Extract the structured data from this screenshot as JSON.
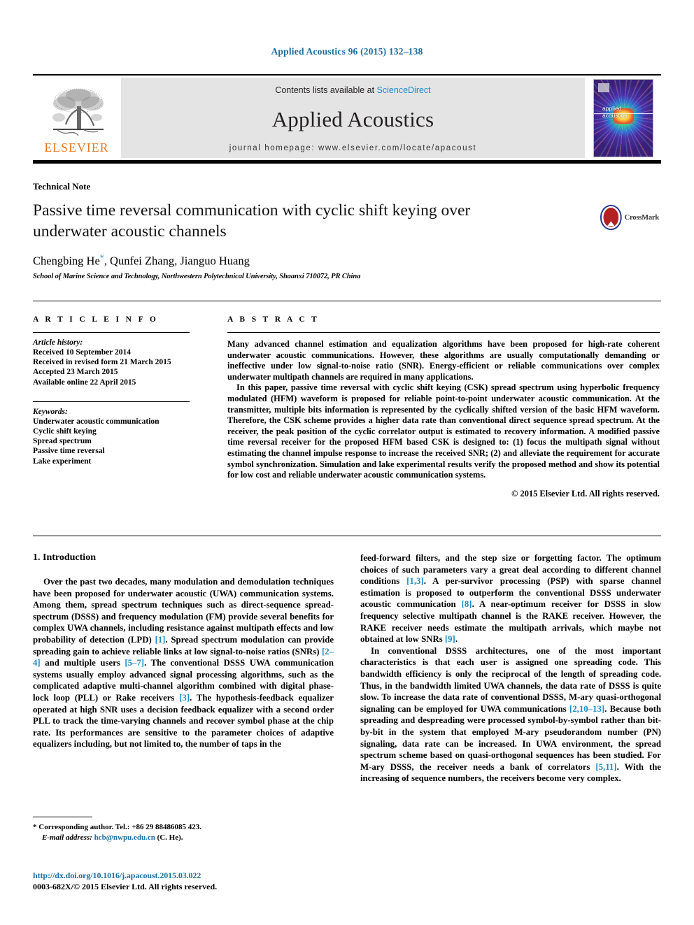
{
  "running_head": "Applied Acoustics 96 (2015) 132–138",
  "masthead": {
    "contents_prefix": "Contents lists available at ",
    "sciencedirect": "ScienceDirect",
    "journal_name": "Applied Acoustics",
    "homepage": "journal homepage: www.elsevier.com/locate/apacoust",
    "publisher": "ELSEVIER",
    "cover_title_line1": "applied",
    "cover_title_line2": "acoustics",
    "accent_blue": "#1a8cc9",
    "elsevier_orange": "#E87722"
  },
  "article": {
    "doctype": "Technical Note",
    "title": "Passive time reversal communication with cyclic shift keying over underwater acoustic channels",
    "authors_pre": "Chengbing He",
    "authors_star": "*",
    "authors_post": ", Qunfei Zhang, Jianguo Huang",
    "affiliation": "School of Marine Science and Technology, Northwestern Polytechnical University, Shaanxi 710072, PR China",
    "crossmark_label": "CrossMark"
  },
  "info": {
    "label": "A R T I C L E  I N F O",
    "history_head": "Article history:",
    "history": [
      "Received 10 September 2014",
      "Received in revised form 21 March 2015",
      "Accepted 23 March 2015",
      "Available online 22 April 2015"
    ],
    "keywords_head": "Keywords:",
    "keywords": [
      "Underwater acoustic communication",
      "Cyclic shift keying",
      "Spread spectrum",
      "Passive time reversal",
      "Lake experiment"
    ]
  },
  "abstract": {
    "label": "A B S T R A C T",
    "paragraphs": [
      "Many advanced channel estimation and equalization algorithms have been proposed for high-rate coherent underwater acoustic communications. However, these algorithms are usually computationally demanding or ineffective under low signal-to-noise ratio (SNR). Energy-efficient or reliable communications over complex underwater multipath channels are required in many applications.",
      "In this paper, passive time reversal with cyclic shift keying (CSK) spread spectrum using hyperbolic frequency modulated (HFM) waveform is proposed for reliable point-to-point underwater acoustic communication. At the transmitter, multiple bits information is represented by the cyclically shifted version of the basic HFM waveform. Therefore, the CSK scheme provides a higher data rate than conventional direct sequence spread spectrum. At the receiver, the peak position of the cyclic correlator output is estimated to recovery information. A modified passive time reversal receiver for the proposed HFM based CSK is designed to: (1) focus the multipath signal without estimating the channel impulse response to increase the received SNR; (2) and alleviate the requirement for accurate symbol synchronization. Simulation and lake experimental results verify the proposed method and show its potential for low cost and reliable underwater acoustic communication systems."
    ],
    "copyright": "© 2015 Elsevier Ltd. All rights reserved."
  },
  "body": {
    "section_heading": "1. Introduction",
    "left_paragraph_1_a": "Over the past two decades, many modulation and demodulation techniques have been proposed for underwater acoustic (UWA) communication systems. Among them, spread spectrum techniques such as direct-sequence spread-spectrum (DSSS) and frequency modulation (FM) provide several benefits for complex UWA channels, including resistance against multipath effects and low probability of detection (LPD) ",
    "ref_1": "[1]",
    "left_paragraph_1_b": ". Spread spectrum modulation can provide spreading gain to achieve reliable links at low signal-to-noise ratios (SNRs) ",
    "ref_2_4": "[2–4]",
    "left_paragraph_1_c": " and multiple users ",
    "ref_5_7": "[5–7]",
    "left_paragraph_1_d": ". The conventional DSSS UWA communication systems usually employ advanced signal processing algorithms, such as the complicated adaptive multi-channel algorithm combined with digital phase-lock loop (PLL) or Rake receivers ",
    "ref_3": "[3]",
    "left_paragraph_1_e": ". The hypothesis-feedback equalizer operated at high SNR uses a decision feedback equalizer with a second order PLL to track the time-varying channels and recover symbol phase at the chip rate. Its performances are sensitive to the parameter choices of adaptive equalizers including, but not limited to, the number of taps in the",
    "right_paragraph_1_a": "feed-forward filters, and the step size or forgetting factor. The optimum choices of such parameters vary a great deal according to different channel conditions ",
    "ref_1_3": "[1,3]",
    "right_paragraph_1_b": ". A per-survivor processing (PSP) with sparse channel estimation is proposed to outperform the conventional DSSS underwater acoustic communication ",
    "ref_8": "[8]",
    "right_paragraph_1_c": ". A near-optimum receiver for DSSS in slow frequency selective multipath channel is the RAKE receiver. However, the RAKE receiver needs estimate the multipath arrivals, which maybe not obtained at low SNRs ",
    "ref_9": "[9]",
    "right_paragraph_1_d": ".",
    "right_paragraph_2_a": "In conventional DSSS architectures, one of the most important characteristics is that each user is assigned one spreading code. This bandwidth efficiency is only the reciprocal of the length of spreading code. Thus, in the bandwidth limited UWA channels, the data rate of DSSS is quite slow. To increase the data rate of conventional DSSS, M-ary quasi-orthogonal signaling can be employed for UWA communications ",
    "ref_2_10_13": "[2,10–13]",
    "right_paragraph_2_b": ". Because both spreading and despreading were processed symbol-by-symbol rather than bit-by-bit in the system that employed M-ary pseudorandom number (PN) signaling, data rate can be increased. In UWA environment, the spread spectrum scheme based on quasi-orthogonal sequences has been studied. For M-ary DSSS, the receiver needs a bank of correlators ",
    "ref_5_11": "[5,11]",
    "right_paragraph_2_c": ". With the increasing of sequence numbers, the receivers become very complex."
  },
  "footnote": {
    "star": "*",
    "corresponding": "Corresponding author. Tel.: +86 29 88486085 423.",
    "email_label": "E-mail address:",
    "email": "hcb@nwpu.edu.cn",
    "email_suffix": "(C. He)."
  },
  "footer": {
    "doi": "http://dx.doi.org/10.1016/j.apacoust.2015.03.022",
    "issn_line": "0003-682X/© 2015 Elsevier Ltd. All rights reserved."
  }
}
